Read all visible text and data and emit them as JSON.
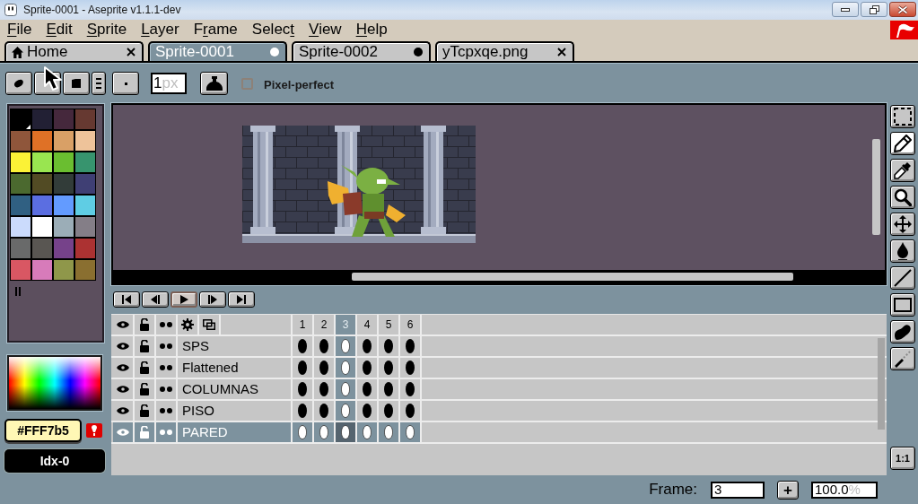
{
  "window": {
    "title": "Sprite-0001 - Aseprite v1.1.1-dev"
  },
  "menu": [
    {
      "key": "F",
      "after": "ile"
    },
    {
      "key": "E",
      "after": "dit"
    },
    {
      "key": "S",
      "after": "prite"
    },
    {
      "key": "L",
      "after": "ayer"
    },
    {
      "before": "F",
      "key": "r",
      "after": "ame"
    },
    {
      "before": "Selec",
      "key": "t"
    },
    {
      "key": "V",
      "after": "iew"
    },
    {
      "key": "H",
      "after": "elp"
    }
  ],
  "tabs": [
    {
      "kind": "home",
      "label": "Home",
      "selected": false,
      "modified": false
    },
    {
      "kind": "document",
      "label": "Sprite-0001",
      "selected": true,
      "modified": true
    },
    {
      "kind": "document",
      "label": "Sprite-0002",
      "selected": false,
      "modified": true
    },
    {
      "kind": "document",
      "label": "yTcpxqe.png",
      "selected": false,
      "modified": false
    }
  ],
  "context_bar": {
    "brush_buttons": [
      {
        "kind": "round"
      },
      {
        "kind": "blank"
      },
      {
        "kind": "square"
      },
      {
        "kind": "lines"
      },
      {
        "kind": "dot"
      }
    ],
    "brush_size": {
      "value": "1",
      "unit": "px"
    },
    "pixel_perfect": {
      "label": "Pixel-perfect",
      "checked": false
    }
  },
  "palette": {
    "swatches": [
      {
        "color": "#000000",
        "selected": true
      },
      {
        "color": "#222034",
        "selected": false
      },
      {
        "color": "#45283c",
        "selected": false
      },
      {
        "color": "#663931",
        "selected": false
      },
      {
        "color": "#8f563b",
        "selected": false
      },
      {
        "color": "#df7126",
        "selected": false
      },
      {
        "color": "#d9a066",
        "selected": false
      },
      {
        "color": "#eec39a",
        "selected": false
      },
      {
        "color": "#fbf236",
        "selected": false
      },
      {
        "color": "#99e550",
        "selected": false
      },
      {
        "color": "#6abe30",
        "selected": false
      },
      {
        "color": "#37946e",
        "selected": false
      },
      {
        "color": "#4b692f",
        "selected": false
      },
      {
        "color": "#524b24",
        "selected": false
      },
      {
        "color": "#323c39",
        "selected": false
      },
      {
        "color": "#3f3f74",
        "selected": false
      },
      {
        "color": "#306082",
        "selected": false
      },
      {
        "color": "#5b6ee1",
        "selected": false
      },
      {
        "color": "#639bff",
        "selected": false
      },
      {
        "color": "#5fcde4",
        "selected": false
      },
      {
        "color": "#cbdbfc",
        "selected": false
      },
      {
        "color": "#ffffff",
        "selected": false
      },
      {
        "color": "#9badb7",
        "selected": false
      },
      {
        "color": "#847e87",
        "selected": false
      },
      {
        "color": "#696a6a",
        "selected": false
      },
      {
        "color": "#595652",
        "selected": false
      },
      {
        "color": "#76428a",
        "selected": false
      },
      {
        "color": "#ac3232",
        "selected": false
      },
      {
        "color": "#d95763",
        "selected": false
      },
      {
        "color": "#d77bba",
        "selected": false
      },
      {
        "color": "#8f974a",
        "selected": false
      },
      {
        "color": "#8a6f30",
        "selected": false
      }
    ]
  },
  "color_bar": {
    "hex": "#FFF7b5",
    "index": "Idx-0"
  },
  "animation_buttons": [
    {
      "kind": "first",
      "hovered": false
    },
    {
      "kind": "previous",
      "hovered": false
    },
    {
      "kind": "play",
      "hovered": true
    },
    {
      "kind": "next",
      "hovered": false
    },
    {
      "kind": "last",
      "hovered": false
    }
  ],
  "timeline": {
    "frames": [
      {
        "label": "1",
        "selected": false
      },
      {
        "label": "2",
        "selected": false
      },
      {
        "label": "3",
        "selected": true
      },
      {
        "label": "4",
        "selected": false
      },
      {
        "label": "5",
        "selected": false
      },
      {
        "label": "6",
        "selected": false
      }
    ],
    "layers": [
      {
        "name": "SPS",
        "visible": true,
        "locked": false,
        "selected": false
      },
      {
        "name": "Flattened",
        "visible": true,
        "locked": false,
        "selected": false
      },
      {
        "name": "COLUMNAS",
        "visible": true,
        "locked": false,
        "selected": false
      },
      {
        "name": "PISO",
        "visible": true,
        "locked": false,
        "selected": false
      },
      {
        "name": "PARED",
        "visible": true,
        "locked": false,
        "selected": true
      }
    ]
  },
  "tools": [
    {
      "kind": "marquee",
      "selected": false
    },
    {
      "kind": "pencil",
      "selected": true
    },
    {
      "kind": "eyedropper",
      "selected": false
    },
    {
      "kind": "zoom",
      "selected": false
    },
    {
      "kind": "move",
      "selected": false
    },
    {
      "kind": "bucket",
      "selected": false
    },
    {
      "kind": "line",
      "selected": false
    },
    {
      "kind": "rectangle",
      "selected": false
    },
    {
      "kind": "contour",
      "selected": false
    },
    {
      "kind": "spray",
      "selected": false
    }
  ],
  "actual_size_button": {
    "label": "1:1"
  },
  "status_bar": {
    "frame_label": "Frame:",
    "frame": "3",
    "add_button": "+",
    "zoom": {
      "value": "100.0",
      "unit": "%"
    }
  }
}
